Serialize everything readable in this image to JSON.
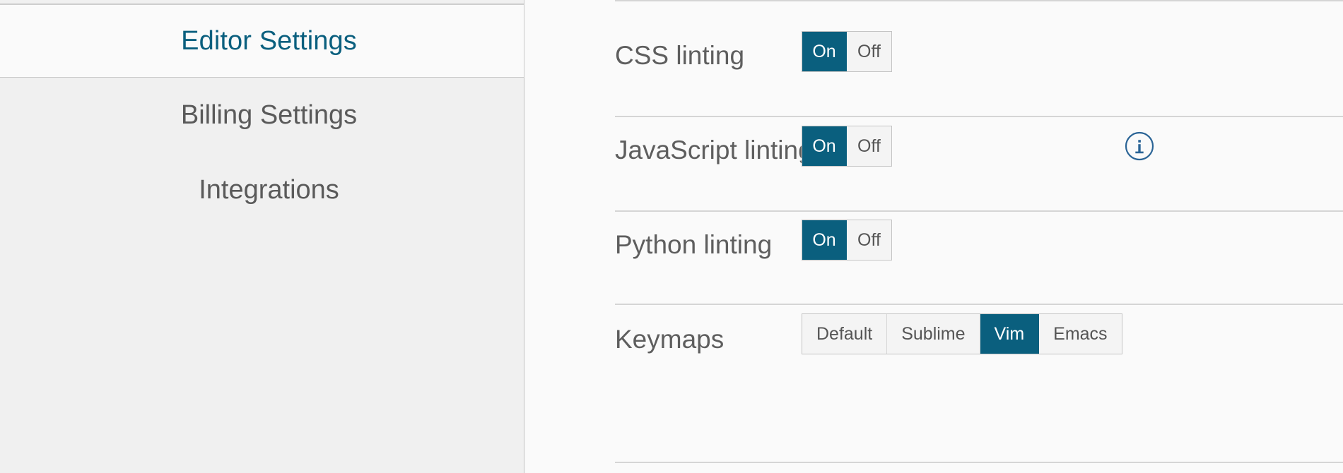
{
  "theme": {
    "accent": "#0a5f7e",
    "page_bg": "#fafafa",
    "sidebar_bg": "#f0f0f0",
    "text": "#5e5e5e",
    "border": "#c4c4c4",
    "divider": "#d5d5d5",
    "info_icon_color": "#2a6496"
  },
  "sidebar": {
    "items": [
      {
        "label": "Editor Settings",
        "active": true
      },
      {
        "label": "Billing Settings",
        "active": false
      },
      {
        "label": "Integrations",
        "active": false
      }
    ]
  },
  "main": {
    "rows": [
      {
        "label": "CSS linting",
        "control": "onoff",
        "options": [
          "On",
          "Off"
        ],
        "selected": "On",
        "has_info": false
      },
      {
        "label": "JavaScript linting",
        "control": "onoff",
        "options": [
          "On",
          "Off"
        ],
        "selected": "On",
        "has_info": true,
        "info_icon": "info-circle-icon"
      },
      {
        "label": "Python linting",
        "control": "onoff",
        "options": [
          "On",
          "Off"
        ],
        "selected": "On",
        "has_info": false
      },
      {
        "label": "Keymaps",
        "control": "keymaps",
        "options": [
          "Default",
          "Sublime",
          "Vim",
          "Emacs"
        ],
        "selected": "Vim",
        "has_info": false
      }
    ]
  }
}
